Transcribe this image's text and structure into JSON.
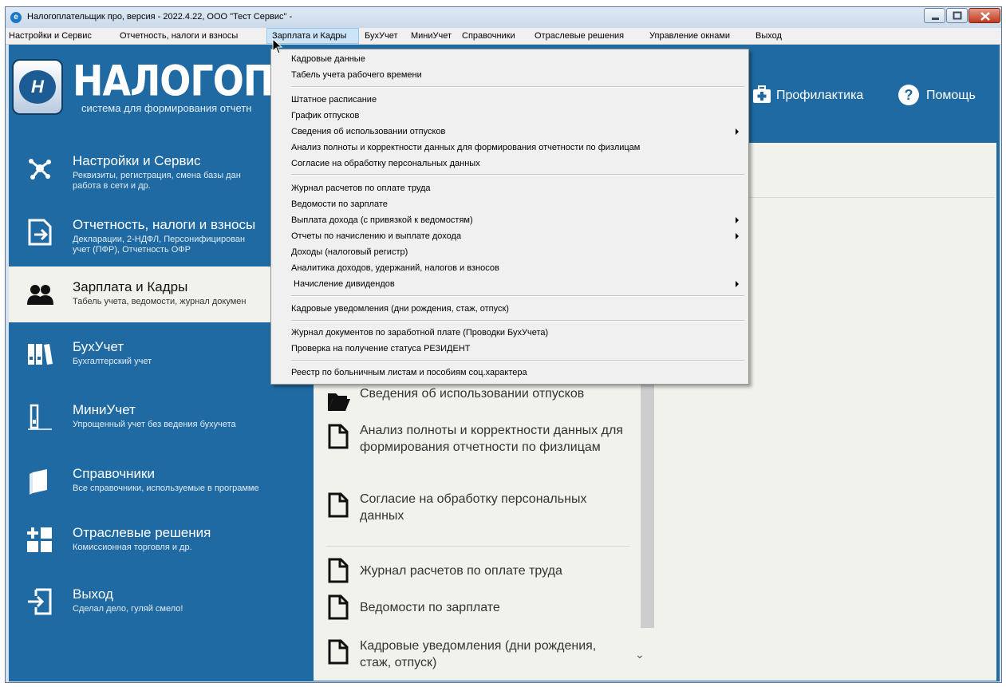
{
  "window": {
    "title": "Налогоплательщик про, версия - 2022.4.22, ООО \"Тест Сервис\" -"
  },
  "menubar": {
    "items": [
      "Настройки и Сервис",
      "Отчетность, налоги и взносы",
      "Зарплата и Кадры",
      "БухУчет",
      "МиниУчет",
      "Справочники",
      "Отраслевые решения",
      "Управление окнами",
      "Выход"
    ]
  },
  "header": {
    "logo_text": "НАЛОГОПЛА",
    "logo_subtitle": "система для формирования отчетн",
    "prof_label": "Профилактика",
    "help_label": "Помощь"
  },
  "sidebar": {
    "items": [
      {
        "title": "Настройки и Сервис",
        "desc": "Реквизиты, регистрация, смена базы дан\nработа в сети и др.",
        "icon": "network-icon"
      },
      {
        "title": "Отчетность, налоги и взносы",
        "desc": "Декларации, 2-НДФЛ, Персонифицирован\nучет (ПФР), Отчетность ОФР",
        "icon": "report-export-icon"
      },
      {
        "title": "Зарплата и Кадры",
        "desc": "Табель учета, ведомости, журнал докумен",
        "icon": "people-icon"
      },
      {
        "title": "БухУчет",
        "desc": "Бухгалтерский учет",
        "icon": "binders-icon"
      },
      {
        "title": "МиниУчет",
        "desc": "Упрощенный учет без ведения бухучета",
        "icon": "single-binder-icon"
      },
      {
        "title": "Справочники",
        "desc": "Все справочники, используемые в программе",
        "icon": "book-icon"
      },
      {
        "title": "Отраслевые решения",
        "desc": "Комиссионная торговля и др.",
        "icon": "plus-tiles-icon"
      },
      {
        "title": "Выход",
        "desc": "Сделал дело, гуляй смело!",
        "icon": "exit-icon"
      }
    ]
  },
  "center_list": {
    "items": [
      "Сведения об использовании отпусков",
      "Анализ полноты и корректности данных для формирования отчетности по физлицам",
      "Согласие на обработку персональных данных",
      "Журнал расчетов по оплате труда",
      "Ведомости по зарплате",
      "Кадровые уведомления (дни рождения, стаж, отпуск)"
    ]
  },
  "dropdown": {
    "items": [
      {
        "label": "Кадровые данные",
        "submenu": false
      },
      {
        "label": "Табель учета рабочего времени",
        "submenu": false
      },
      {
        "label": "Штатное расписание",
        "submenu": false
      },
      {
        "label": "График отпусков",
        "submenu": false
      },
      {
        "label": "Сведения об использовании отпусков",
        "submenu": true
      },
      {
        "label": "Анализ полноты и корректности данных для формирования отчетности по физлицам",
        "submenu": false
      },
      {
        "label": "Согласие на обработку персональных данных",
        "submenu": false
      },
      {
        "label": "Журнал расчетов по оплате труда",
        "submenu": false
      },
      {
        "label": "Ведомости по зарплате",
        "submenu": false
      },
      {
        "label": "Выплата дохода (с привязкой к ведомостям)",
        "submenu": true
      },
      {
        "label": "Отчеты по начислению и выплате дохода",
        "submenu": true
      },
      {
        "label": "Доходы (налоговый регистр)",
        "submenu": false
      },
      {
        "label": "Аналитика доходов, удержаний, налогов и взносов",
        "submenu": false
      },
      {
        "label": " Начисление дивидендов",
        "submenu": true
      },
      {
        "label": "Кадровые уведомления (дни рождения, стаж, отпуск)",
        "submenu": false
      },
      {
        "label": "Журнал документов по заработной плате (Проводки БухУчета)",
        "submenu": false
      },
      {
        "label": "Проверка на получение статуса РЕЗИДЕНТ",
        "submenu": false
      },
      {
        "label": "Реестр по больничным листам и пособиям соц.характера",
        "submenu": false
      }
    ]
  },
  "colors": {
    "panel_blue": "#1f6aa2",
    "panel_light": "#f2f2ec",
    "menu_bg": "#f0f0f0",
    "menu_highlight": "#cce4f7"
  }
}
